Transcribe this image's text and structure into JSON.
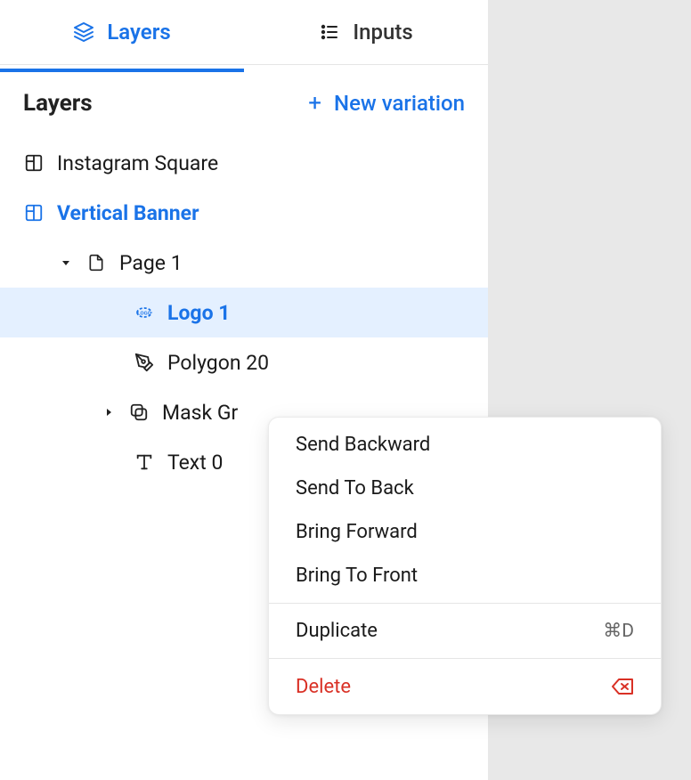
{
  "tabs": {
    "layers": "Layers",
    "inputs": "Inputs"
  },
  "section": {
    "title": "Layers",
    "newVariation": "New variation"
  },
  "tree": {
    "instagramSquare": "Instagram Square",
    "verticalBanner": "Vertical Banner",
    "page1": "Page 1",
    "logo1": "Logo 1",
    "polygon20": "Polygon 20",
    "maskGroup": "Mask Group",
    "maskGroupTruncated": "Mask Gr",
    "text0": "Text 0"
  },
  "contextMenu": {
    "sendBackward": "Send Backward",
    "sendToBack": "Send To Back",
    "bringForward": "Bring Forward",
    "bringToFront": "Bring To Front",
    "duplicate": "Duplicate",
    "duplicateShortcut": "⌘D",
    "delete": "Delete"
  }
}
